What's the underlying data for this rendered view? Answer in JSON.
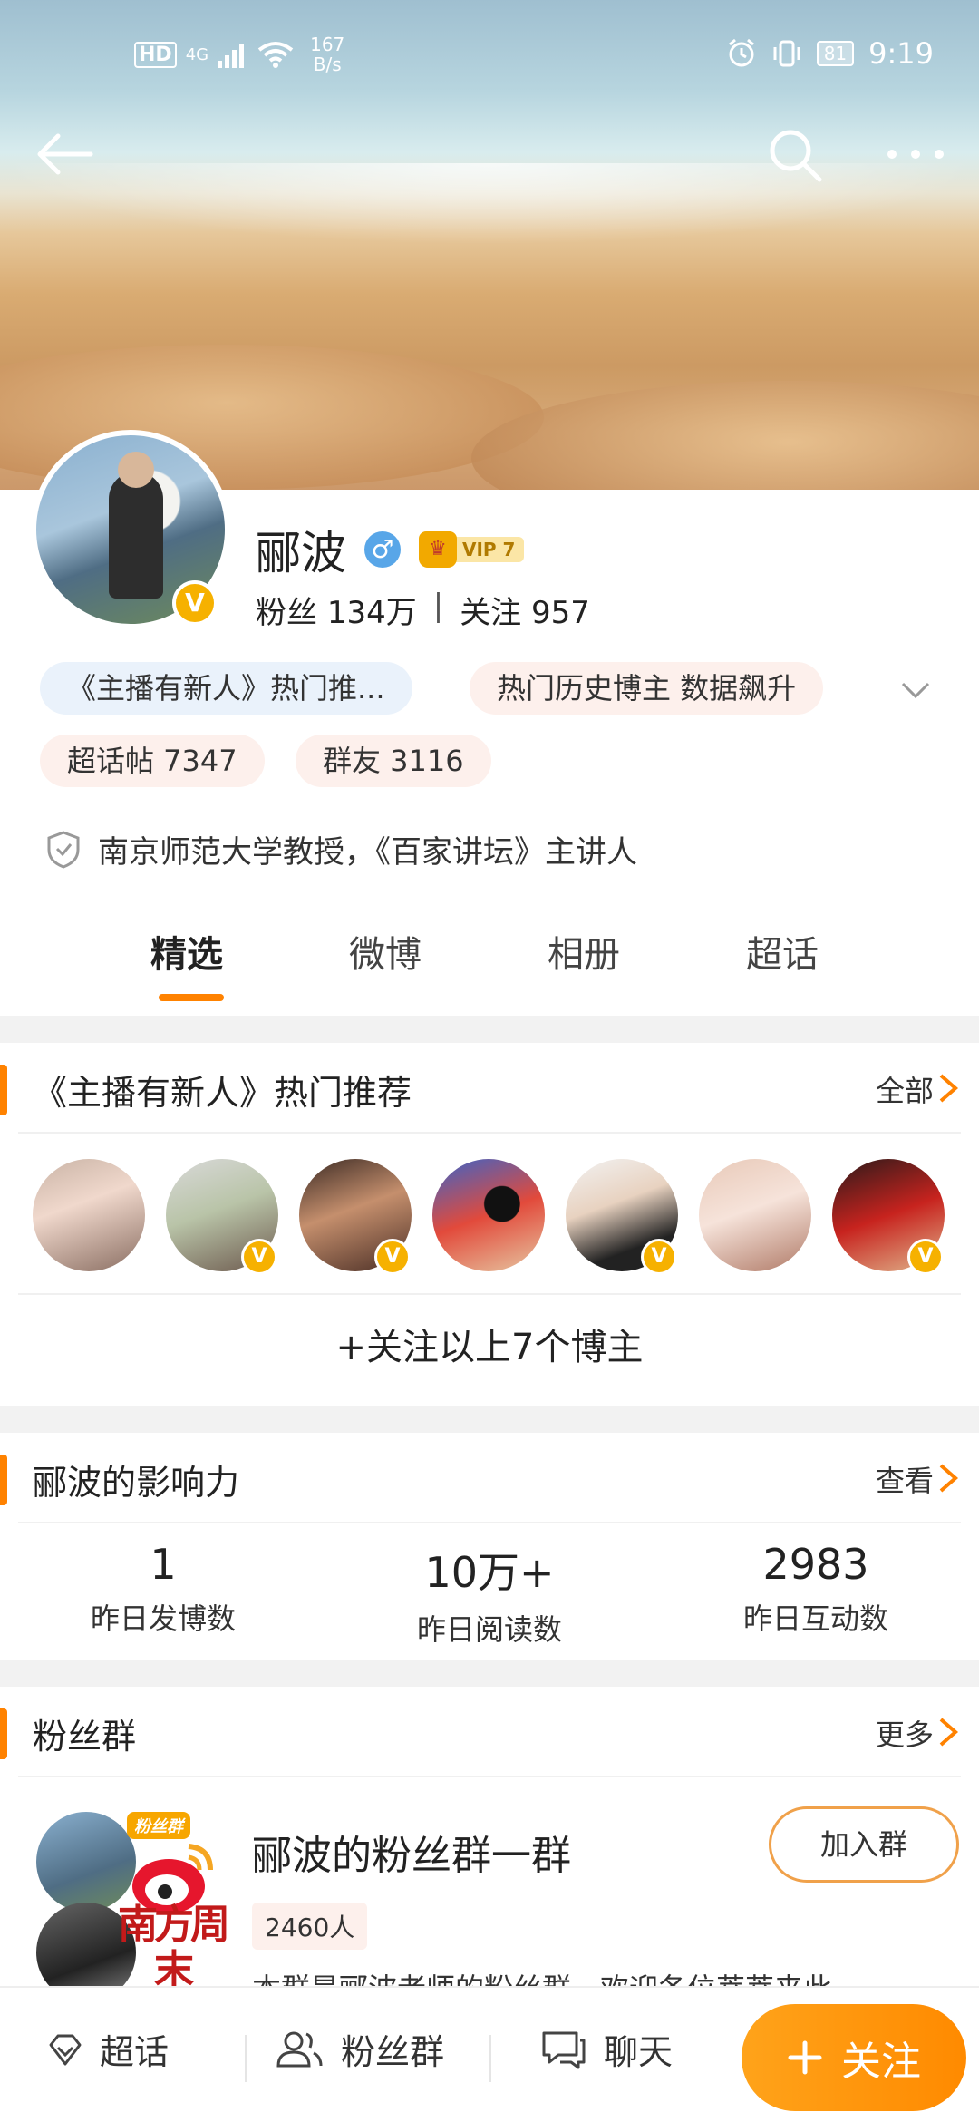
{
  "status_bar": {
    "hd": "HD",
    "network": "4G",
    "speed_value": "167",
    "speed_unit": "B/s",
    "battery": "81",
    "time": "9:19"
  },
  "profile": {
    "name": "郦波",
    "vip_level": "VIP 7",
    "fans_label": "粉丝",
    "fans_count": "134万",
    "follow_label": "关注",
    "follow_count": "957",
    "tags": [
      "《主播有新人》热门推...",
      "热门历史博主 数据飙升",
      "超话帖 7347",
      "群友 3116"
    ],
    "bio": "南京师范大学教授，《百家讲坛》主讲人"
  },
  "tabs": [
    "精选",
    "微博",
    "相册",
    "超话"
  ],
  "recommend": {
    "title": "《主播有新人》热门推荐",
    "link": "全部",
    "follow_all": "+关注以上7个博主"
  },
  "impact": {
    "title": "郦波的影响力",
    "link": "查看",
    "metrics": [
      {
        "value": "1",
        "label": "昨日发博数"
      },
      {
        "value": "10万+",
        "label": "昨日阅读数"
      },
      {
        "value": "2983",
        "label": "昨日互动数"
      }
    ]
  },
  "fan_group": {
    "title": "粉丝群",
    "link": "更多",
    "badge": "粉丝群",
    "stamp": "南方周末",
    "name": "郦波的粉丝群一群",
    "count": "2460人",
    "description": "本群是郦波老师的粉丝群，欢迎各位莘莘来此",
    "join_label": "加入群"
  },
  "bottom_bar": {
    "items": [
      "超话",
      "粉丝群",
      "聊天"
    ],
    "follow_label": "关注"
  },
  "colors": {
    "accent": "#ff8200",
    "verified": "#f6b100"
  }
}
